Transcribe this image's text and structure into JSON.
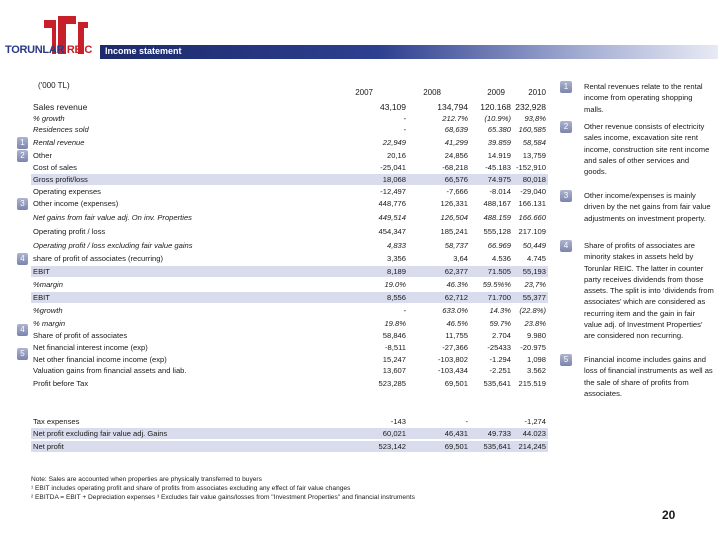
{
  "logo": {
    "brand": "TORUNLAR",
    "suffix": "REIC",
    "colors": {
      "blue": "#2a3a86",
      "red": "#c8202a"
    }
  },
  "header": {
    "title": "Income statement"
  },
  "unit_label": "('000 TL)",
  "years": [
    "2007",
    "2008",
    "2009",
    "2010"
  ],
  "rows": [
    {
      "label": "Sales revenue",
      "values": [
        "43,109",
        "134,794",
        "120.168",
        "232,928"
      ]
    },
    {
      "label": "% growth",
      "values": [
        "-",
        "212.7%",
        "(10.9%)",
        "93,8%"
      ]
    },
    {
      "label": "Residences sold",
      "values": [
        "-",
        "68,639",
        "65.380",
        "160,585"
      ]
    },
    {
      "label": "Rental revenue",
      "values": [
        "22,949",
        "41,299",
        "39.859",
        "58,584"
      ]
    },
    {
      "label": "Other",
      "values": [
        "20,16",
        "24,856",
        "14.919",
        "13,759"
      ]
    },
    {
      "label": "Cost of sales",
      "values": [
        "-25,041",
        "-68,218",
        "-45.183",
        "-152,910"
      ]
    },
    {
      "label": "Gross profit/loss",
      "values": [
        "18,068",
        "66,576",
        "74.975",
        "80,018"
      ]
    },
    {
      "label": "Operating expenses",
      "values": [
        "-12,497",
        "-7,666",
        "-8.014",
        "-29,040"
      ]
    },
    {
      "label": "Other income (expenses)",
      "values": [
        "448,776",
        "126,331",
        "488,167",
        "166.131"
      ]
    },
    {
      "label": "Net gains from fair value adj. On inv. Properties",
      "values": [
        "449,514",
        "126,504",
        "488.159",
        "166.660"
      ]
    },
    {
      "label": "Operating profit / loss",
      "values": [
        "454,347",
        "185,241",
        "555,128",
        "217.109"
      ]
    },
    {
      "label": "Operating profit / loss excluding fair value gains",
      "values": [
        "4,833",
        "58,737",
        "66.969",
        "50,449"
      ]
    },
    {
      "label": "share of profit of associates (recurring)",
      "values": [
        "3,356",
        "3,64",
        "4.536",
        "4.745"
      ]
    },
    {
      "label": "EBIT",
      "values": [
        "8,189",
        "62,377",
        "71.505",
        "55,193"
      ]
    },
    {
      "label": "%margin",
      "values": [
        "19.0%",
        "46.3%",
        "59.5%%",
        "23,7%"
      ]
    },
    {
      "label": "EBIT",
      "values": [
        "8,556",
        "62,712",
        "71.700",
        "55,377"
      ]
    },
    {
      "label": "%growth",
      "values": [
        "-",
        "633.0%",
        "14.3%",
        "(22.8%)"
      ]
    },
    {
      "label": "% margin",
      "values": [
        "19.8%",
        "46.5%",
        "59.7%",
        "23.8%"
      ]
    },
    {
      "label": "Share of profit of associates",
      "values": [
        "58,846",
        "11,755",
        "2.704",
        "9.980"
      ]
    },
    {
      "label": "Net financial interest income (exp)",
      "values": [
        "-8,511",
        "-27,366",
        "-25433",
        "-20.975"
      ]
    },
    {
      "label": "Net other financial income income (exp)",
      "values": [
        "15,247",
        "-103,802",
        "-1.294",
        "1,098"
      ]
    },
    {
      "label": "Valuation gains from financial assets and liab.",
      "values": [
        "13,607",
        "-103,434",
        "-2.251",
        "3.562"
      ]
    },
    {
      "label": "Profit before Tax",
      "values": [
        "523,285",
        "69,501",
        "535,641",
        "215.519"
      ]
    },
    {
      "label": "Tax expenses",
      "values": [
        "-143",
        "-",
        "",
        "-1,274"
      ]
    },
    {
      "label": "Net profit excluding fair value adj. Gains",
      "values": [
        "60,021",
        "46,431",
        "49.733",
        "44.023"
      ]
    },
    {
      "label": "Net profit",
      "values": [
        "523,142",
        "69,501",
        "535,641",
        "214,245"
      ]
    }
  ],
  "row_markers": [
    "1",
    "2",
    "3",
    "4",
    "4",
    "5"
  ],
  "notes": [
    {
      "num": "1",
      "text": "Rental revenues relate to the rental income from operating shopping malls."
    },
    {
      "num": "2",
      "text": "Other revenue consists of electricity sales income, excavation site rent income, construction site rent income and sales of other services and goods."
    },
    {
      "num": "3",
      "text": "Other income/expenses is mainly driven by the net gains from fair value adjustments on investment property."
    },
    {
      "num": "4",
      "text": "Share of profits of associates are minority stakes in assets held by Torunlar REIC. The latter in counter party receives dividends from those assets. The split is into ‘dividends from associates’ which are considered as recurring item and the gain in fair value adj. of Investment Properties’ are considered non recurring."
    },
    {
      "num": "5",
      "text": "Financial income includes gains and loss of financial instruments as well as the sale of share of profits from associates."
    }
  ],
  "footnotes": [
    "Note: Sales are accounted when properties are physically transferred to buyers",
    "¹ EBIT includes operating profit and share of profits from associates excluding any effect of fair value changes",
    "² EBITDA = EBIT + Depreciation expenses ³ Excludes fair value gains/losses from \"Investment Properties\" and financial instruments"
  ],
  "page_number": "20"
}
